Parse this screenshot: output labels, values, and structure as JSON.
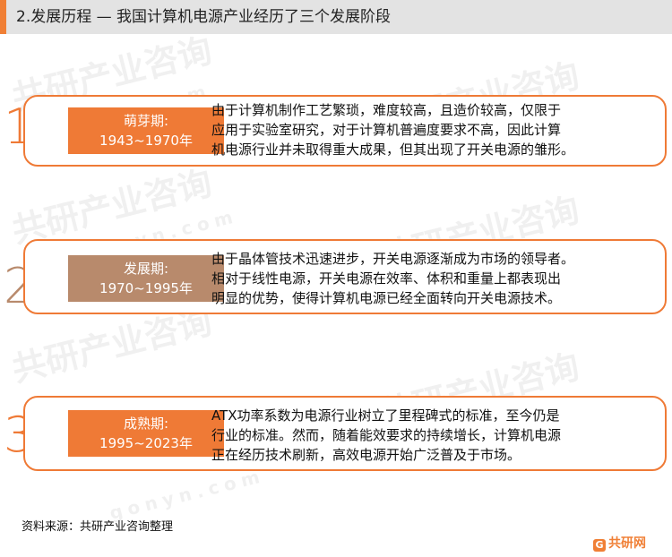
{
  "header": {
    "title": "2.发展历程 — 我国计算机电源产业经历了三个发展阶段"
  },
  "watermark": {
    "brand": "共研产业咨询",
    "domain": "gonyn.com"
  },
  "stages": [
    {
      "number": "1",
      "name": "萌芽期:",
      "period": "1943~1970年",
      "lines": [
        "由于计算机制作工艺繁琐，难度较高，且造价较高，仅限于",
        "应用于实验室研究，对于计算机普遍度要求不高，因此计算",
        "机电源行业并未取得重大成果，但其出现了开关电源的雏形。"
      ],
      "color": "#ef7a36"
    },
    {
      "number": "2",
      "name": "发展期:",
      "period": "1970~1995年",
      "lines": [
        "由于晶体管技术迅速进步，开关电源逐渐成为市场的领导者。",
        "相对于线性电源，开关电源在效率、体积和重量上都表现出",
        "明显的优势，使得计算机电源已经全面转向开关电源技术。"
      ],
      "color": "#b88a6c"
    },
    {
      "number": "3",
      "name": "成熟期:",
      "period": "1995~2023年",
      "lines": [
        "ATX功率系数为电源行业树立了里程碑式的标准，至今仍是",
        "行业的标准。然而，随着能效要求的持续增长，计算机电源",
        "正在经历技术刷新，高效电源开始广泛普及于市场。"
      ],
      "color": "#ef7a36"
    }
  ],
  "footer": {
    "source": "资料来源：共研产业咨询整理",
    "logo_mark": "G",
    "logo_text": "共研网"
  },
  "colors": {
    "accent": "#f07f35",
    "title_bar": "#e3e3e3",
    "stage_brown": "#b88a6c"
  }
}
